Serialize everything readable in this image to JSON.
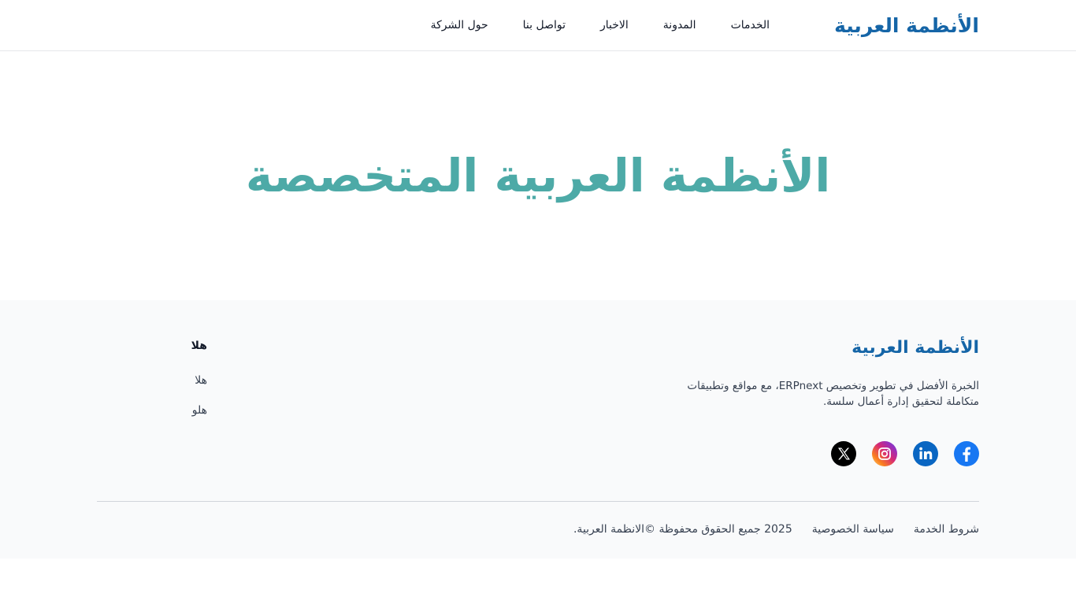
{
  "header": {
    "brand": "الأنظمة العربية",
    "nav": [
      {
        "label": "الخدمات"
      },
      {
        "label": "المدونة"
      },
      {
        "label": "الاخبار"
      },
      {
        "label": "تواصل بنا"
      },
      {
        "label": "حول الشركة"
      }
    ]
  },
  "hero": {
    "title": "الأنظمة العربية المتخصصة"
  },
  "footer": {
    "brand": "الأنظمة العربية",
    "description": "الخبرة الأفضل في تطوير وتخصيص ERPnext، مع مواقع وتطبيقات متكاملة لتحقيق إدارة أعمال سلسة.",
    "social": [
      {
        "icon": "facebook-icon"
      },
      {
        "icon": "linkedin-icon"
      },
      {
        "icon": "instagram-icon"
      },
      {
        "icon": "x-icon"
      }
    ],
    "column": {
      "title": "هلا",
      "links": [
        {
          "label": "هلا"
        },
        {
          "label": "هلو"
        }
      ]
    },
    "bottom": {
      "terms": "شروط الخدمة",
      "privacy": "سياسة الخصوصية",
      "copyright": "2025 جميع الحقوق محفوظة ©الانظمة العربية."
    }
  },
  "colors": {
    "brand": "#1565a7",
    "hero": "#4daaa7",
    "footer_bg": "#f9fafb"
  }
}
